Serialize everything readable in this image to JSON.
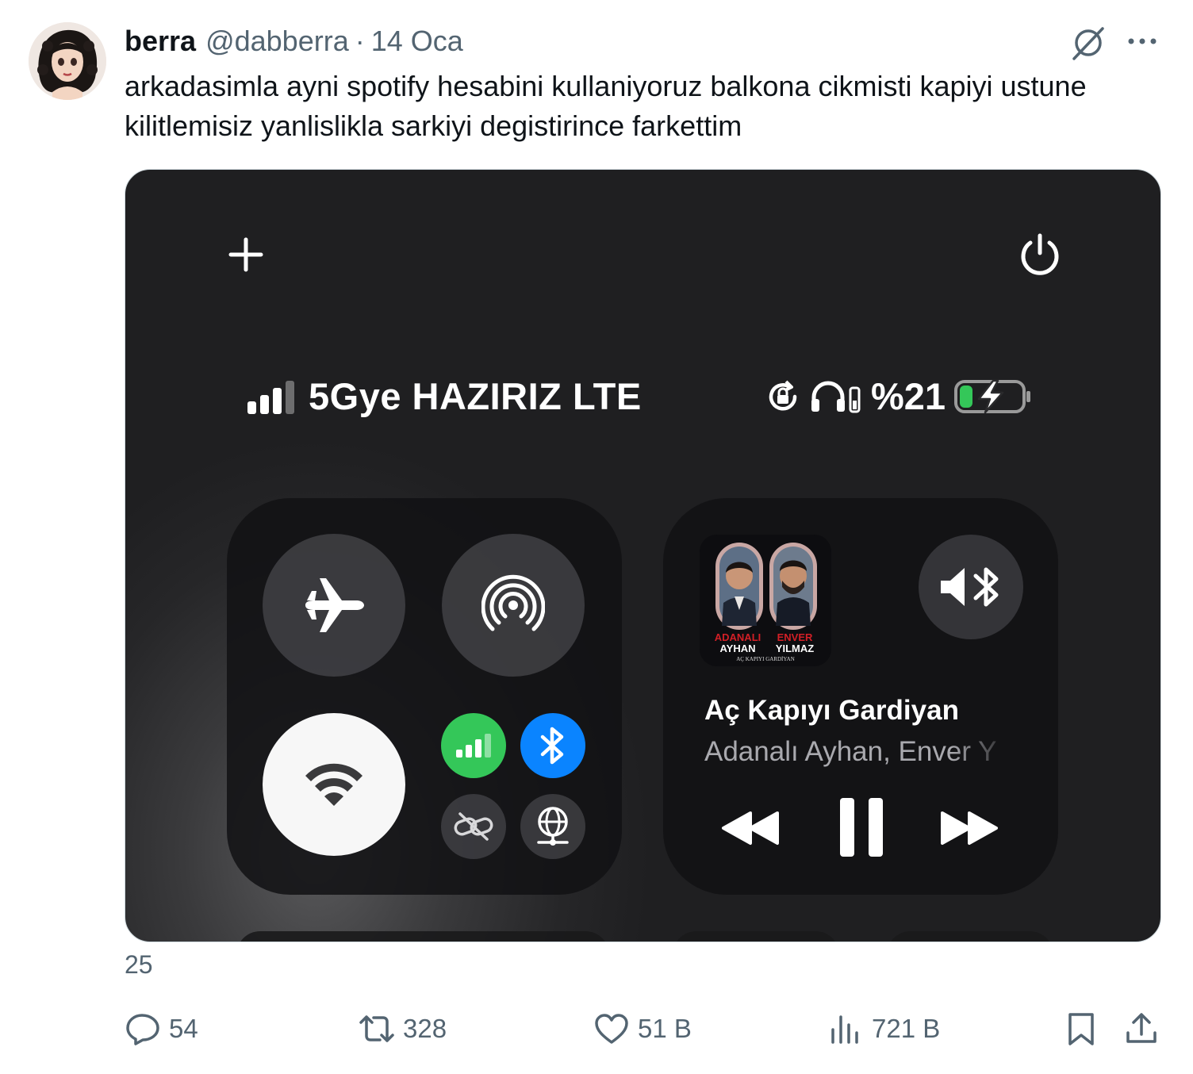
{
  "tweet": {
    "author_name": "berra",
    "handle": "@dabberra",
    "separator": "·",
    "date": "14 Oca",
    "text": "arkadasimla ayni spotify hesabini kullaniyoruz balkona cikmisti kapiyi ustune kilitlemisiz yanlislikla sarkiyi degistirince farkettim",
    "media_count_label": "25"
  },
  "control_center": {
    "carrier": "5Gye HAZIRIZ LTE",
    "battery_percent": "%21",
    "battery_level": 0.21,
    "signal_bars": 3,
    "now_playing": {
      "title": "Aç Kapıyı Gardiyan",
      "artist": "Adanalı Ayhan, Enver Y",
      "album_art_text": {
        "artist1_surname": "ADANALI",
        "artist1_name": "AYHAN",
        "artist2_name": "ENVER",
        "artist2_surname": "YILMAZ",
        "album": "AÇ KAPIYI GARDİYAN"
      }
    },
    "toggles": {
      "airplane": "off",
      "airdrop": "off",
      "wifi": "on",
      "cellular": "on",
      "bluetooth": "on",
      "personal_hotspot": "off",
      "vpn": "off"
    },
    "icons": [
      "plus-icon",
      "power-icon",
      "airplane-icon",
      "airdrop-icon",
      "wifi-icon",
      "cellular-icon",
      "bluetooth-icon",
      "link-off-icon",
      "globe-icon",
      "audio-output-bluetooth-icon",
      "rewind-icon",
      "pause-icon",
      "fast-forward-icon",
      "orientation-lock-icon",
      "headphones-icon",
      "battery-charging-icon"
    ]
  },
  "actions": {
    "replies": "54",
    "reposts": "328",
    "likes": "51 B",
    "views": "721 B"
  },
  "colors": {
    "text_primary": "#0f1419",
    "text_secondary": "#536471",
    "cc_green": "#34c759",
    "cc_blue": "#0a84ff"
  }
}
